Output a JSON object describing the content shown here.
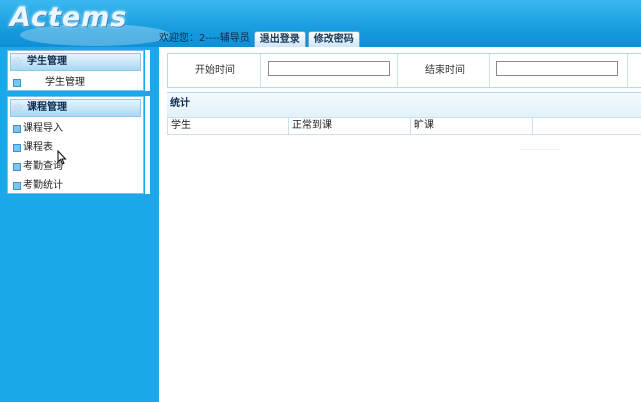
{
  "header": {
    "logo_text": "Actems",
    "welcome": "欢迎您：2----辅导员",
    "logout_label": "退出登录",
    "change_password_label": "修改密码"
  },
  "sidebar": {
    "student_panel": {
      "title": "学生管理",
      "items": [
        {
          "label": "学生管理"
        }
      ]
    },
    "course_panel": {
      "title": "课程管理",
      "items": [
        {
          "label": "课程导入"
        },
        {
          "label": "课程表"
        },
        {
          "label": "考勤查询"
        },
        {
          "label": "考勤统计"
        }
      ]
    }
  },
  "filter": {
    "start_label": "开始时间",
    "start_value": "",
    "end_label": "结束时间",
    "end_value": ""
  },
  "stats": {
    "title": "统计",
    "columns": [
      "学生",
      "正常到课",
      "旷课"
    ]
  },
  "colors": {
    "sidebar_bg": "#1aa8ea",
    "header_bg": "#1a9fe0",
    "panel_border": "#7fbfe6"
  }
}
